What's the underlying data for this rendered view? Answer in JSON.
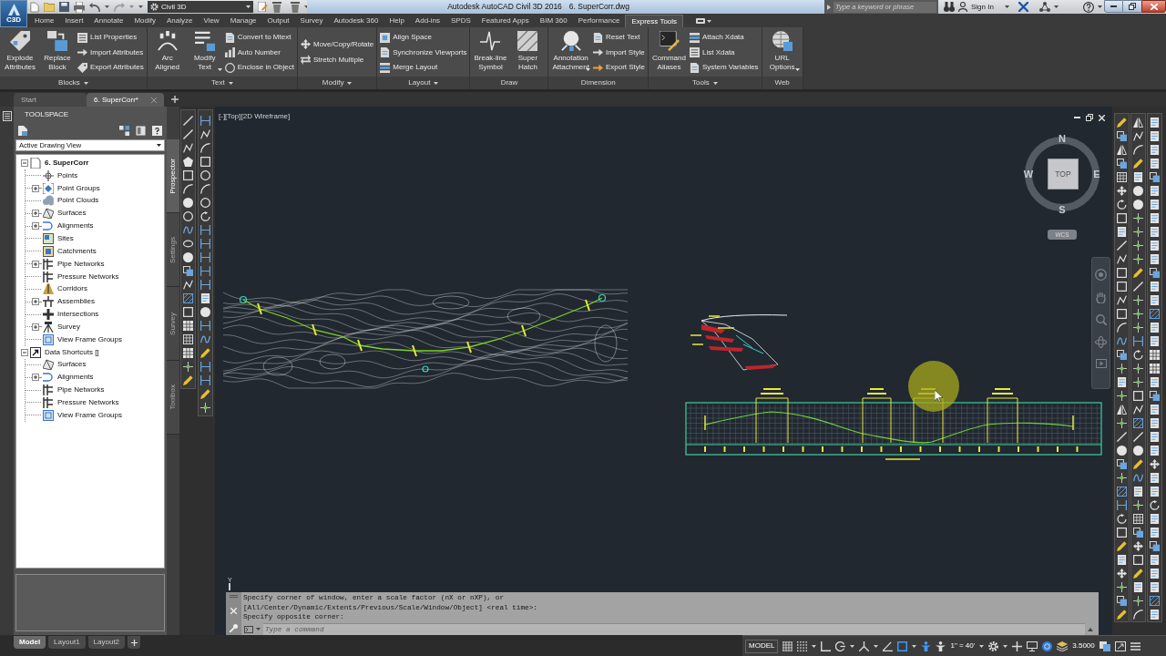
{
  "app_button": {
    "label": "C3D"
  },
  "title_bar": {
    "workspace": "Civil 3D",
    "app_title": "Autodesk AutoCAD Civil 3D 2016",
    "file_name": "6. SuperCorr.dwg",
    "search": {
      "placeholder": "Type a keyword or phrase"
    },
    "sign_in": "Sign In"
  },
  "menu_tabs": [
    {
      "label": "Home",
      "selected": false
    },
    {
      "label": "Insert",
      "selected": false
    },
    {
      "label": "Annotate",
      "selected": false
    },
    {
      "label": "Modify",
      "selected": false
    },
    {
      "label": "Analyze",
      "selected": false
    },
    {
      "label": "View",
      "selected": false
    },
    {
      "label": "Manage",
      "selected": false
    },
    {
      "label": "Output",
      "selected": false
    },
    {
      "label": "Survey",
      "selected": false
    },
    {
      "label": "Autodesk 360",
      "selected": false
    },
    {
      "label": "Help",
      "selected": false
    },
    {
      "label": "Add-ins",
      "selected": false
    },
    {
      "label": "SPDS",
      "selected": false
    },
    {
      "label": "Featured Apps",
      "selected": false
    },
    {
      "label": "BIM 360",
      "selected": false
    },
    {
      "label": "Performance",
      "selected": false
    },
    {
      "label": "Express Tools",
      "selected": true
    }
  ],
  "ribbon": {
    "panels": [
      {
        "title": "Blocks",
        "menu": true,
        "buttons": [
          {
            "kind": "large",
            "label": "Explode Attributes",
            "dropdown": false
          },
          {
            "kind": "large",
            "label": "Replace Block",
            "dropdown": false
          },
          {
            "kind": "small",
            "label": "List Properties",
            "dropdown": false
          },
          {
            "kind": "small",
            "label": "Import Attributes",
            "dropdown": false
          },
          {
            "kind": "small",
            "label": "Export Attributes",
            "dropdown": false
          }
        ]
      },
      {
        "title": "Text",
        "menu": true,
        "buttons": [
          {
            "kind": "large",
            "label": "Arc Aligned",
            "dropdown": false
          },
          {
            "kind": "large",
            "label": "Modify Text",
            "dropdown": true
          },
          {
            "kind": "small",
            "label": "Convert to Mtext",
            "dropdown": false
          },
          {
            "kind": "small",
            "label": "Auto Number",
            "dropdown": false
          },
          {
            "kind": "small",
            "label": "Enclose in Object",
            "dropdown": false
          }
        ]
      },
      {
        "title": "Modify",
        "menu": true,
        "buttons": [
          {
            "kind": "small",
            "label": "Move/Copy/Rotate",
            "dropdown": false
          },
          {
            "kind": "small",
            "label": "Stretch Multiple",
            "dropdown": false
          }
        ]
      },
      {
        "title": "Layout",
        "menu": true,
        "buttons": [
          {
            "kind": "small",
            "label": "Align Space",
            "dropdown": false
          },
          {
            "kind": "small",
            "label": "Synchronize Viewports",
            "dropdown": false
          },
          {
            "kind": "small",
            "label": "Merge Layout",
            "dropdown": false
          }
        ]
      },
      {
        "title": "Draw",
        "menu": false,
        "buttons": [
          {
            "kind": "large",
            "label": "Break-line Symbol",
            "dropdown": false
          },
          {
            "kind": "large",
            "label": "Super Hatch",
            "dropdown": false
          }
        ]
      },
      {
        "title": "Dimension",
        "menu": false,
        "buttons": [
          {
            "kind": "large",
            "label": "Annotation Attachment",
            "dropdown": true
          },
          {
            "kind": "small",
            "label": "Reset Text",
            "dropdown": false
          },
          {
            "kind": "small",
            "label": "Import Style",
            "dropdown": false
          },
          {
            "kind": "small",
            "label": "Export Style",
            "dropdown": false
          }
        ]
      },
      {
        "title": "Tools",
        "menu": true,
        "buttons": [
          {
            "kind": "large",
            "label": "Command Aliases",
            "dropdown": false
          },
          {
            "kind": "small",
            "label": "Attach Xdata",
            "dropdown": false
          },
          {
            "kind": "small",
            "label": "List Xdata",
            "dropdown": false
          },
          {
            "kind": "small",
            "label": "System Variables",
            "dropdown": false
          }
        ]
      },
      {
        "title": "Web",
        "menu": false,
        "buttons": [
          {
            "kind": "large",
            "label": "URL Options",
            "dropdown": true
          }
        ]
      }
    ]
  },
  "file_tabs": [
    {
      "label": "Start",
      "selected": false
    },
    {
      "label": "6. SuperCorr*",
      "selected": true
    }
  ],
  "toolspace": {
    "title": "TOOLSPACE",
    "view": "Active Drawing View",
    "tree": [
      {
        "label": "6. SuperCorr",
        "active": true,
        "collapsed": false,
        "children": [
          {
            "label": "Points",
            "collapsed": false
          },
          {
            "label": "Point Groups",
            "collapsed": true
          },
          {
            "label": "Point Clouds",
            "collapsed": false
          },
          {
            "label": "Surfaces",
            "collapsed": true
          },
          {
            "label": "Alignments",
            "collapsed": true
          },
          {
            "label": "Sites",
            "collapsed": false
          },
          {
            "label": "Catchments",
            "collapsed": false
          },
          {
            "label": "Pipe Networks",
            "collapsed": true
          },
          {
            "label": "Pressure Networks",
            "collapsed": false
          },
          {
            "label": "Corridors",
            "collapsed": false
          },
          {
            "label": "Assemblies",
            "collapsed": true
          },
          {
            "label": "Intersections",
            "collapsed": false
          },
          {
            "label": "Survey",
            "collapsed": true
          },
          {
            "label": "View Frame Groups",
            "collapsed": false
          }
        ]
      },
      {
        "label": "Data Shortcuts []",
        "active": false,
        "collapsed": false,
        "children": [
          {
            "label": "Surfaces",
            "collapsed": false
          },
          {
            "label": "Alignments",
            "collapsed": true
          },
          {
            "label": "Pipe Networks",
            "collapsed": false
          },
          {
            "label": "Pressure Networks",
            "collapsed": false
          },
          {
            "label": "View Frame Groups",
            "collapsed": false
          }
        ]
      }
    ],
    "side_tabs": [
      {
        "label": "Prospector",
        "selected": true
      },
      {
        "label": "Settings",
        "selected": false
      },
      {
        "label": "Survey",
        "selected": false
      },
      {
        "label": "Toolbox",
        "selected": false
      }
    ]
  },
  "viewport": {
    "label": "[-][Top][2D Wireframe]",
    "viewcube": {
      "north": "N",
      "west": "W",
      "face": "TOP",
      "east": "E",
      "south": "S",
      "ucs": "WCS"
    },
    "ucs_axis": "Y"
  },
  "command_line": {
    "history": [
      "Specify corner of window, enter a scale factor (nX or nXP), or",
      "[All/Center/Dynamic/Extents/Previous/Scale/Window/Object] <real time>:",
      "Specify opposite corner:"
    ],
    "placeholder": "Type a command"
  },
  "layout_tabs": [
    {
      "label": "Model",
      "selected": true
    },
    {
      "label": "Layout1",
      "selected": false
    },
    {
      "label": "Layout2",
      "selected": false
    }
  ],
  "status_bar": {
    "space": "MODEL",
    "toggles": [
      {
        "on": false
      },
      {
        "on": false
      },
      {
        "on": false
      },
      {
        "on": false
      },
      {
        "on": false
      },
      {
        "on": false
      },
      {
        "on": true
      },
      {
        "on": true
      },
      {
        "on": false
      }
    ],
    "scale": "1\" = 40'",
    "isolate": {
      "on": true
    },
    "units": "3.5000"
  }
}
